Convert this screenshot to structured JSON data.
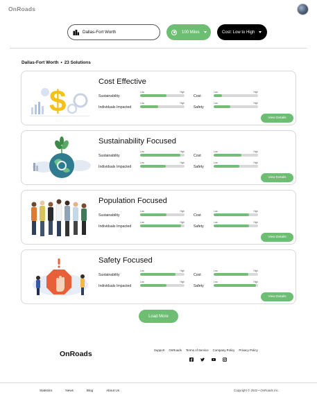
{
  "header": {
    "brand": "OnRoads"
  },
  "filters": {
    "location": "Dallas-Fort Worth",
    "distance": "100 Miles",
    "sort": "Cost: Low to High"
  },
  "results": {
    "location": "Dallas-Fort Worth",
    "separator": "•",
    "count": "23 Solutions"
  },
  "cards": [
    {
      "title": "Cost Effective",
      "labels": [
        "Sustainability",
        "Cost",
        "Individuals Impacted",
        "Safety"
      ],
      "levels": [
        0.6,
        0.18,
        0.4,
        0.38
      ],
      "low": "Low",
      "high": "High",
      "cta": "View Details"
    },
    {
      "title": "Sustainability Focused",
      "labels": [
        "Sustainability",
        "Cost",
        "Individuals Impacted",
        "Safety"
      ],
      "levels": [
        0.9,
        0.62,
        0.58,
        0.58
      ],
      "low": "Low",
      "high": "High",
      "cta": "View Details"
    },
    {
      "title": "Population Focused",
      "labels": [
        "Sustainability",
        "Cost",
        "Individuals Impacted",
        "Safety"
      ],
      "levels": [
        0.6,
        0.8,
        0.92,
        0.8
      ],
      "low": "Low",
      "high": "High",
      "cta": "View Details"
    },
    {
      "title": "Safety Focused",
      "labels": [
        "Sustainability",
        "Cost",
        "Individuals Impacted",
        "Safety"
      ],
      "levels": [
        0.8,
        0.78,
        0.6,
        0.95
      ],
      "low": "Low",
      "high": "High",
      "cta": "View Details"
    }
  ],
  "load_more": "Load More",
  "footer": {
    "brand": "OnRoads",
    "links": [
      "Support",
      "OnRoads",
      "Terms of Service",
      "Company Policy",
      "Privacy Policy"
    ],
    "social": [
      "facebook-icon",
      "twitter-icon",
      "youtube-icon",
      "instagram-icon"
    ],
    "bottom_links": [
      "Statistics",
      "News",
      "Blog",
      "About Us"
    ],
    "copyright": "Copyright © 2022 • OnRoads Inc."
  },
  "colors": {
    "accent": "#6dbd73",
    "fill": "#74bd79",
    "track": "#d9d9d9",
    "dark": "#000000"
  }
}
